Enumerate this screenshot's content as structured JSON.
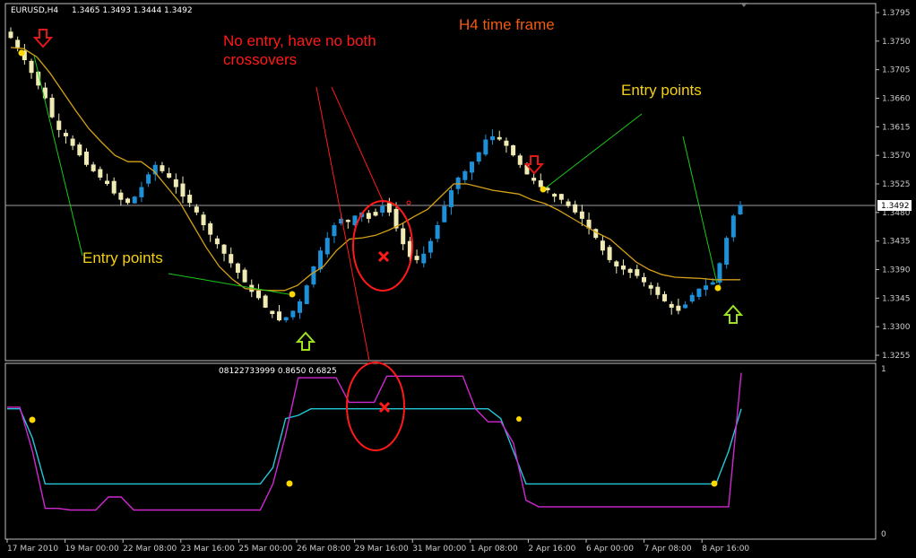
{
  "chart_header": {
    "symbol": "EURUSD,H4",
    "ohlc": "1.3465 1.3493 1.3444 1.3492",
    "indicator_values": "08122733999  0.8650  0.6825"
  },
  "annotations": {
    "timeframe": "H4 time frame",
    "no_entry_line1": "No entry, have no both",
    "no_entry_line2": "crossovers",
    "entry_points_left": "Entry points",
    "entry_points_right": "Entry points"
  },
  "price_axis": {
    "ticks": [
      "1.3795",
      "1.3750",
      "1.3705",
      "1.3660",
      "1.3615",
      "1.3570",
      "1.3525",
      "1.3480",
      "1.3435",
      "1.3390",
      "1.3345",
      "1.3300",
      "1.3255"
    ],
    "current_price": "1.3492"
  },
  "indicator_axis": {
    "ticks": [
      "1",
      "0"
    ]
  },
  "time_axis": {
    "ticks": [
      "17 Mar 2010",
      "19 Mar 00:00",
      "22 Mar 08:00",
      "23 Mar 16:00",
      "25 Mar 00:00",
      "26 Mar 08:00",
      "29 Mar 16:00",
      "31 Mar 00:00",
      "1 Apr 08:00",
      "2 Apr 16:00",
      "6 Apr 00:00",
      "7 Apr 08:00",
      "8 Apr 16:00"
    ]
  },
  "colors": {
    "bull": "#1e90d8",
    "bear": "#f0ebb4",
    "ma": "#d4a018",
    "signal_cyan": "#22c8d8",
    "signal_magenta": "#d028d0",
    "annotation_red": "#ff1a1a",
    "annotation_yellow": "#f4d010",
    "annotation_orange": "#f05a14",
    "pointer_green": "#19c819"
  },
  "chart_data": [
    {
      "type": "candlestick",
      "title": "EURUSD,H4",
      "ylim": [
        1.3255,
        1.382
      ],
      "close_path": [
        1.3755,
        1.374,
        1.372,
        1.37,
        1.368,
        1.366,
        1.363,
        1.361,
        1.36,
        1.3585,
        1.357,
        1.3555,
        1.3545,
        1.3535,
        1.3525,
        1.351,
        1.35,
        1.3495,
        1.3505,
        1.352,
        1.354,
        1.3555,
        1.3545,
        1.3535,
        1.352,
        1.3505,
        1.3495,
        1.348,
        1.346,
        1.3445,
        1.343,
        1.3415,
        1.34,
        1.3385,
        1.337,
        1.3355,
        1.3345,
        1.333,
        1.332,
        1.331,
        1.3315,
        1.3325,
        1.334,
        1.3365,
        1.3395,
        1.342,
        1.344,
        1.346,
        1.347,
        1.3465,
        1.3475,
        1.348,
        1.347,
        1.3475,
        1.349,
        1.348,
        1.3455,
        1.343,
        1.341,
        1.3405,
        1.3415,
        1.3435,
        1.346,
        1.349,
        1.3515,
        1.3535,
        1.3545,
        1.356,
        1.3575,
        1.3595,
        1.36,
        1.3595,
        1.3585,
        1.357,
        1.3555,
        1.354,
        1.353,
        1.352,
        1.3515,
        1.3505,
        1.35,
        1.349,
        1.348,
        1.347,
        1.3455,
        1.344,
        1.342,
        1.3405,
        1.3395,
        1.339,
        1.3385,
        1.338,
        1.337,
        1.336,
        1.335,
        1.334,
        1.333,
        1.3325,
        1.3335,
        1.335,
        1.336,
        1.3365,
        1.337,
        1.34,
        1.344,
        1.3475,
        1.3492
      ],
      "ma_path": [
        1.374,
        1.3738,
        1.3725,
        1.37,
        1.367,
        1.364,
        1.3612,
        1.359,
        1.357,
        1.356,
        1.356,
        1.3545,
        1.352,
        1.3495,
        1.346,
        1.3425,
        1.3395,
        1.3375,
        1.336,
        1.3358,
        1.3357,
        1.3357,
        1.3365,
        1.3382,
        1.3395,
        1.342,
        1.3438,
        1.344,
        1.3444,
        1.3452,
        1.3462,
        1.3474,
        1.3485,
        1.3505,
        1.3525,
        1.3525,
        1.352,
        1.3515,
        1.3512,
        1.3509,
        1.35,
        1.3494,
        1.3484,
        1.3472,
        1.346,
        1.3448,
        1.3438,
        1.342,
        1.3402,
        1.339,
        1.3382,
        1.3378,
        1.3377,
        1.3376,
        1.3374,
        1.3374,
        1.3374
      ]
    },
    {
      "type": "line",
      "ylim": [
        0,
        1
      ],
      "series": [
        {
          "color": "#22c8d8",
          "values": [
            0.76,
            0.76,
            0.58,
            0.3,
            0.3,
            0.3,
            0.3,
            0.3,
            0.3,
            0.3,
            0.3,
            0.3,
            0.3,
            0.3,
            0.3,
            0.3,
            0.3,
            0.3,
            0.3,
            0.3,
            0.3,
            0.4,
            0.7,
            0.72,
            0.76,
            0.76,
            0.76,
            0.76,
            0.76,
            0.76,
            0.76,
            0.76,
            0.76,
            0.76,
            0.76,
            0.76,
            0.76,
            0.76,
            0.76,
            0.7,
            0.5,
            0.3,
            0.3,
            0.3,
            0.3,
            0.3,
            0.3,
            0.3,
            0.3,
            0.3,
            0.3,
            0.3,
            0.3,
            0.3,
            0.3,
            0.3,
            0.3,
            0.5,
            0.76
          ]
        },
        {
          "color": "#d028d0",
          "values": [
            0.77,
            0.77,
            0.5,
            0.15,
            0.15,
            0.14,
            0.14,
            0.14,
            0.22,
            0.22,
            0.14,
            0.14,
            0.14,
            0.14,
            0.14,
            0.14,
            0.14,
            0.14,
            0.14,
            0.14,
            0.14,
            0.3,
            0.6,
            0.95,
            0.95,
            0.95,
            0.95,
            0.8,
            0.8,
            0.8,
            0.96,
            0.96,
            0.96,
            0.96,
            0.96,
            0.96,
            0.96,
            0.76,
            0.68,
            0.68,
            0.55,
            0.2,
            0.16,
            0.16,
            0.16,
            0.16,
            0.16,
            0.16,
            0.16,
            0.16,
            0.16,
            0.16,
            0.16,
            0.16,
            0.16,
            0.16,
            0.16,
            0.16,
            0.98
          ]
        }
      ]
    }
  ]
}
